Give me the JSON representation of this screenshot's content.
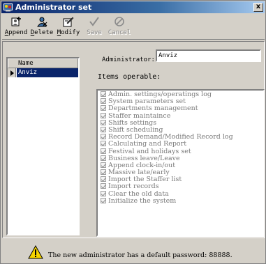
{
  "window": {
    "title": "Administrator set",
    "close_label": "x"
  },
  "toolbar": {
    "append": "Append",
    "delete": "Delete",
    "modify": "Modify",
    "save": "Save",
    "cancel": "Cancel"
  },
  "user_list": {
    "header": "Name",
    "rows": [
      "Anviz"
    ]
  },
  "form": {
    "administrator_label": "Administrator:",
    "administrator_value": "Anviz",
    "items_label": "Items operable:"
  },
  "items": [
    "Admin. settings/operatings log",
    "System parameters set",
    "Departments management",
    "Staffer maintaince",
    "Shifts settings",
    "Shift scheduling",
    "Record Demand/Modified Record log",
    "Calculating and Report",
    "Festival and holidays set",
    "Business leave/Leave",
    "Append clock-in/out",
    "Massive late/early",
    "Import the Staffer list",
    "Import records",
    "Clear the old data",
    "Initialize the system"
  ],
  "status": {
    "message": "The new administrator has a default password: 88888."
  },
  "colors": {
    "title_bar": "#0a246a",
    "selection": "#0a246a",
    "face": "#d4d0c8",
    "ok_green": "#3aa12a",
    "cancel_red": "#d41f1f",
    "warning_yellow": "#f5d400"
  }
}
